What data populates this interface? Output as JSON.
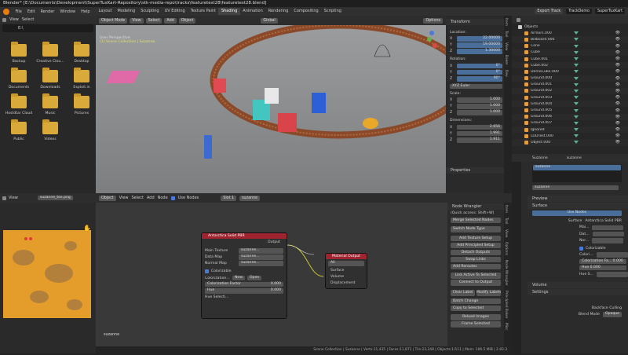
{
  "window_title": "Blender* [E:\\Documents\\Development\\SuperTuxKart-Repository\\stk-media-repo\\tracks\\featuretest28\\featuretest28.blend]",
  "menu": [
    "File",
    "Edit",
    "Render",
    "Window",
    "Help"
  ],
  "workspaces": [
    "Layout",
    "Modeling",
    "Sculpting",
    "UV Editing",
    "Texture Paint",
    "Shading",
    "Animation",
    "Rendering",
    "Compositing",
    "Scripting"
  ],
  "active_workspace": "Shading",
  "top_right": {
    "export": "Export Track",
    "scene": "TrackDemo",
    "engine": "SuperTuxKart"
  },
  "file_browser": {
    "view": "View",
    "select": "Select",
    "path": "E:\\",
    "folders": [
      "Backup",
      "Creative Clou...",
      "Desktop",
      "Documents",
      "Downloads",
      "Exploit.in",
      "Hostdtar Cloud",
      "Music",
      "Pictures",
      "Public",
      "Videos"
    ]
  },
  "viewport": {
    "mode": "Object Mode",
    "menus": [
      "View",
      "Select",
      "Add",
      "Object"
    ],
    "orientation": "Global",
    "options": "Options",
    "overlay_lines": [
      "User Perspective",
      "(1) Scene Collection | Suzanne"
    ]
  },
  "transform": {
    "header": "Transform",
    "location_label": "Location:",
    "location": [
      {
        "axis": "X",
        "value": "22.00000"
      },
      {
        "axis": "Y",
        "value": "19.00000"
      },
      {
        "axis": "Z",
        "value": "1.30000"
      }
    ],
    "rotation_label": "Rotation:",
    "rotation": [
      {
        "axis": "X",
        "value": "0°"
      },
      {
        "axis": "Y",
        "value": "0°"
      },
      {
        "axis": "Z",
        "value": "90°"
      }
    ],
    "euler": "XYZ Euler",
    "scale_label": "Scale:",
    "scale": [
      {
        "axis": "X",
        "value": "1.000"
      },
      {
        "axis": "Y",
        "value": "1.000"
      },
      {
        "axis": "Z",
        "value": "1.000"
      }
    ],
    "dimensions_label": "Dimensions:",
    "dimensions": [
      {
        "axis": "X",
        "value": "2.656"
      },
      {
        "axis": "Y",
        "value": "1.991"
      },
      {
        "axis": "Z",
        "value": "1.911"
      }
    ],
    "properties": "Properties",
    "tabs": [
      "Item",
      "Tool",
      "View",
      "Baker",
      "Dev"
    ]
  },
  "outliner": {
    "root": "Objects",
    "items": [
      "Armors.000",
      "Billboard.000",
      "Cone",
      "Cube",
      "Cube.001",
      "Cube.002",
      "DemoCube.000",
      "Ground.000",
      "Ground.001",
      "Ground.002",
      "Ground.003",
      "Ground.004",
      "Ground.005",
      "Ground.006",
      "Ground.007",
      "Ignored",
      "LODTest.000",
      "Object.000"
    ]
  },
  "props": {
    "object": "Suzanne",
    "material_slot": "suzanne",
    "material_name": "suzanne",
    "preview": "Preview",
    "surface": "Surface",
    "use_nodes": "Use Nodes",
    "surface_label": "Surface",
    "surface_value": "Antarctica Solid PBR",
    "mai": "Mai...",
    "dat": "Dat...",
    "nor": "Nor...",
    "colorizable": "Colorizable",
    "colori": "Colori...",
    "colorization": "Colorization Fa...",
    "colorization_value": "0.000",
    "hue_label": "Hue",
    "hue_value": "0.000",
    "hue_s": "Hue S...",
    "volume": "Volume",
    "settings": "Settings",
    "backface": "Backface Culling",
    "blend_mode_label": "Blend Mode",
    "blend_mode": "Opaque"
  },
  "node_header": {
    "editor": "Object",
    "menus": [
      "View",
      "Select",
      "Add",
      "Node"
    ],
    "use_nodes": "Use Nodes",
    "slot": "Slot 1",
    "material": "suzanne"
  },
  "image_editor": {
    "view": "View",
    "image": "suzanne_tex.png"
  },
  "node_main": {
    "title": "Antarctica Solid PBR",
    "output": "Output",
    "inputs": [
      {
        "label": "Main Texture",
        "value": "suzanne..."
      },
      {
        "label": "Data Map",
        "value": "suzanne..."
      },
      {
        "label": "Normal Map",
        "value": "suzanne..."
      }
    ],
    "colorizable": "Colorizable",
    "colorization_label": "Colorization...",
    "new": "New",
    "open": "Open",
    "factor_label": "Colorization Factor",
    "factor_value": "0.000",
    "hue_label": "Hue",
    "hue_value": "0.000",
    "hue_sel": "Hue Selecti..."
  },
  "node_output": {
    "title": "Material Output",
    "target": "All",
    "sockets": [
      "Surface",
      "Volume",
      "Displacement"
    ]
  },
  "node_name": "suzanne",
  "node_wrangler": {
    "header": "Node Wrangler",
    "quick": "(Quick access: Shift+W)",
    "merge": "Merge Selected Nodes",
    "switch": "Switch Node Type",
    "btns": [
      "Add Texture Setup",
      "Add Principled Setup",
      "Detach Outputs",
      "Swap Links"
    ],
    "add_reroutes": "Add Reroutes",
    "link_active": "Link Active To Selected",
    "connect": "Connect to Output",
    "clear_label": "Clear Label",
    "modify_labels": "Modify Labels",
    "batch": "Batch Change",
    "copy_sel": "Copy to Selected",
    "reload": "Reload Images",
    "frame": "Frame Selected",
    "tabs": [
      "Item",
      "Tool",
      "View",
      "Options",
      "Node Wrangler",
      "Principled Baker",
      "Misc"
    ]
  },
  "status": "Scene Collection | Suzanne | Verts:11,435 | Faces:11,871 | Tris:23,248 | Objects:1/111 | Mem: 106.5 MiB | 2.83.3"
}
